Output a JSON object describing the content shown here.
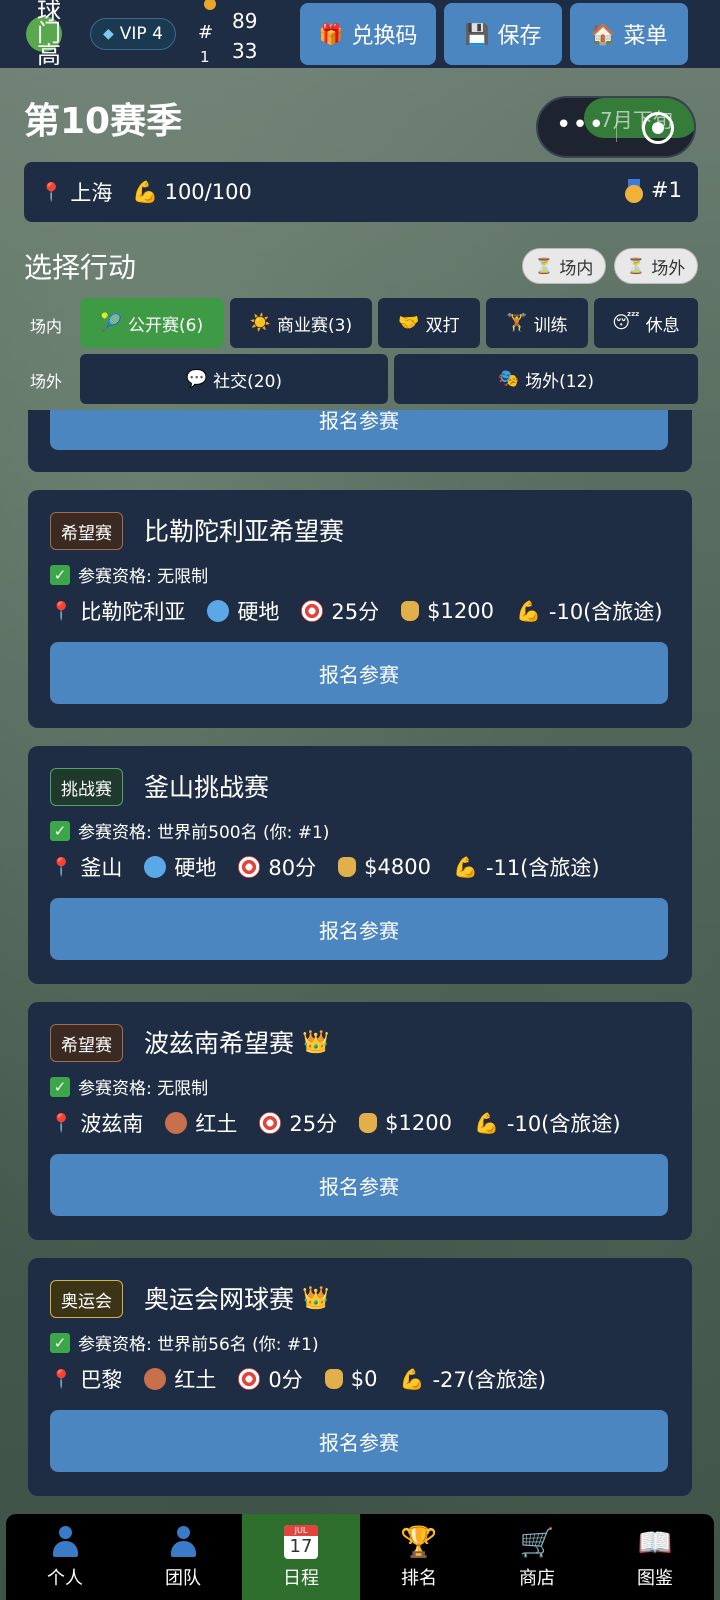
{
  "topbar": {
    "logo_text": "球门高",
    "vip_label": "VIP 4",
    "rank_hash": "#",
    "rank_one": "1",
    "stat1": "89",
    "stat2": "33",
    "redeem_label": "兑换码",
    "save_label": "保存",
    "menu_label": "菜单"
  },
  "season": {
    "title": "第10赛季",
    "capsule_month": "7月下旬",
    "capsule_dots": "•••"
  },
  "location": {
    "city": "上海",
    "energy": "100/100",
    "rank": "#1"
  },
  "actions": {
    "title": "选择行动",
    "chip_inside": "场内",
    "chip_outside": "场外",
    "row_inside": "场内",
    "row_outside": "场外",
    "tabs": [
      {
        "label": "公开赛(6)",
        "icon": "tennis-ball"
      },
      {
        "label": "商业赛(3)",
        "icon": "sun"
      },
      {
        "label": "双打",
        "icon": "handshake"
      },
      {
        "label": "训练",
        "icon": "trophy"
      },
      {
        "label": "休息",
        "icon": "sleep"
      }
    ],
    "outside_tabs": [
      {
        "label": "社交(20)",
        "icon": "speech"
      },
      {
        "label": "场外(12)",
        "icon": "masks"
      }
    ]
  },
  "partial_card": {
    "signup_label": "报名参赛"
  },
  "tournaments": [
    {
      "badge": "希望赛",
      "name": "比勒陀利亚希望赛",
      "crown": false,
      "eligibility": "参赛资格: 无限制",
      "location": "比勒陀利亚",
      "surface": "硬地",
      "points": "25分",
      "prize": "$1200",
      "energy": "-10(含旅途)",
      "signup": "报名参赛"
    },
    {
      "badge": "挑战赛",
      "name": "釜山挑战赛",
      "crown": false,
      "eligibility": "参赛资格: 世界前500名 (你: #1)",
      "location": "釜山",
      "surface": "硬地",
      "points": "80分",
      "prize": "$4800",
      "energy": "-11(含旅途)",
      "signup": "报名参赛"
    },
    {
      "badge": "希望赛",
      "name": "波兹南希望赛",
      "crown": true,
      "eligibility": "参赛资格: 无限制",
      "location": "波兹南",
      "surface": "红土",
      "points": "25分",
      "prize": "$1200",
      "energy": "-10(含旅途)",
      "signup": "报名参赛"
    },
    {
      "badge": "奥运会",
      "name": "奥运会网球赛",
      "crown": true,
      "eligibility": "参赛资格: 世界前56名 (你: #1)",
      "location": "巴黎",
      "surface": "红土",
      "points": "0分",
      "prize": "$0",
      "energy": "-27(含旅途)",
      "signup": "报名参赛"
    }
  ],
  "nav": [
    {
      "label": "个人",
      "icon": "person-icon"
    },
    {
      "label": "团队",
      "icon": "team-icon"
    },
    {
      "label": "日程",
      "icon": "calendar-icon",
      "day": "17"
    },
    {
      "label": "排名",
      "icon": "trophy-icon"
    },
    {
      "label": "商店",
      "icon": "cart-icon"
    },
    {
      "label": "图鉴",
      "icon": "book-icon"
    }
  ],
  "colors": {
    "panel": "#1e2c44",
    "accent_blue": "#4b86c0",
    "active_green": "#3e9a44"
  }
}
